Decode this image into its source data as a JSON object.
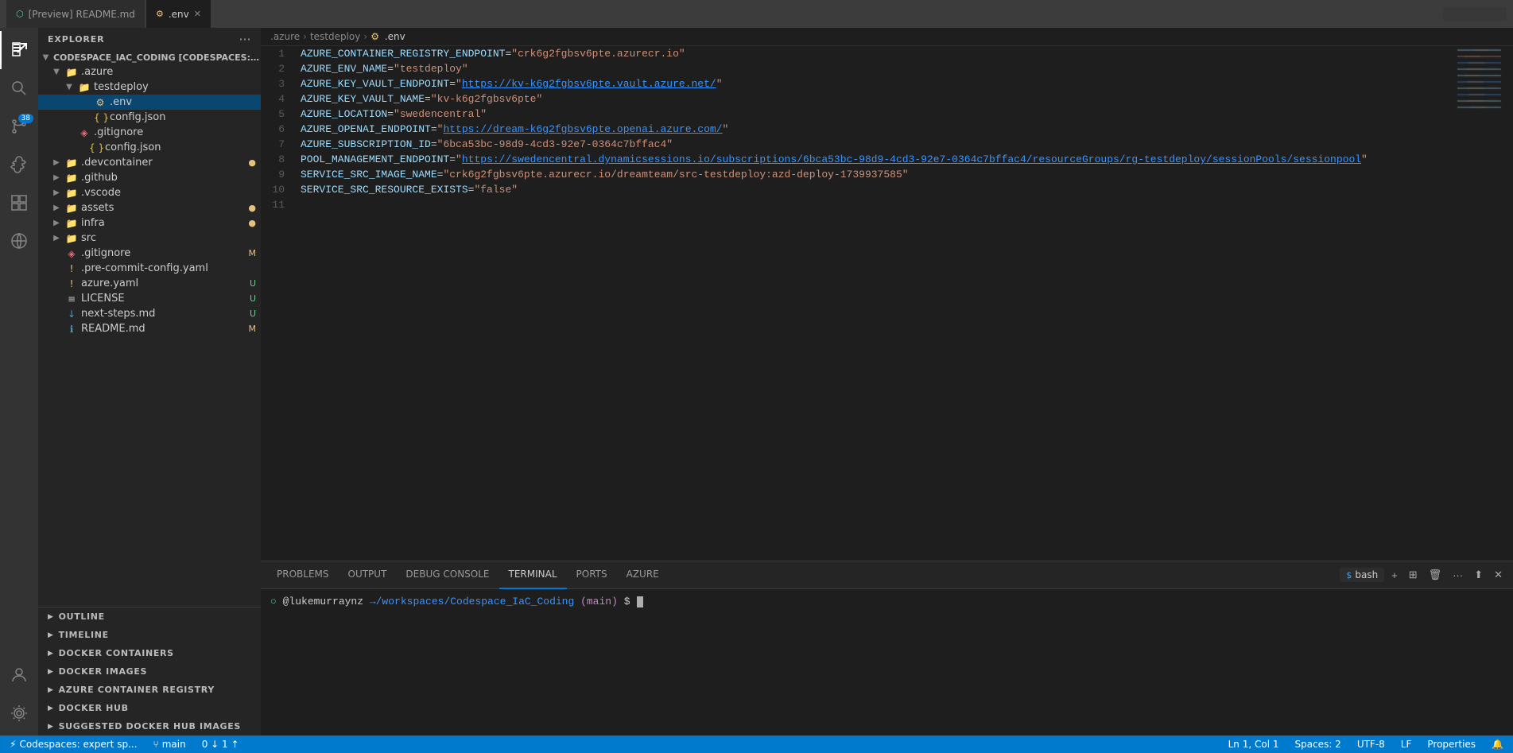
{
  "titlebar": {
    "tabs": [
      {
        "id": "preview-readme",
        "label": "[Preview] README.md",
        "icon": "preview",
        "active": false
      },
      {
        "id": "env",
        "label": ".env",
        "icon": "env",
        "active": true,
        "closeable": true
      }
    ]
  },
  "breadcrumb": {
    "parts": [
      ".azure",
      "testdeploy",
      ".env"
    ]
  },
  "activity": {
    "items": [
      {
        "id": "explorer",
        "icon": "files",
        "active": true
      },
      {
        "id": "search",
        "icon": "search",
        "active": false
      },
      {
        "id": "git",
        "icon": "git",
        "active": false,
        "badge": "38"
      },
      {
        "id": "debug",
        "icon": "debug",
        "active": false
      },
      {
        "id": "extensions",
        "icon": "extensions",
        "active": false
      },
      {
        "id": "remote",
        "icon": "remote",
        "active": false
      },
      {
        "id": "accounts",
        "icon": "accounts",
        "active": false
      },
      {
        "id": "settings",
        "icon": "settings",
        "active": false
      }
    ]
  },
  "sidebar": {
    "title": "EXPLORER",
    "root_label": "CODESPACE_IAC_CODING [CODESPACES: EXPERT SP...]",
    "tree": [
      {
        "indent": 0,
        "type": "folder-open",
        "label": ".azure",
        "expanded": true
      },
      {
        "indent": 1,
        "type": "folder-open",
        "label": "testdeploy",
        "expanded": true
      },
      {
        "indent": 2,
        "type": "file-env",
        "label": ".env",
        "selected": true
      },
      {
        "indent": 3,
        "type": "file-json",
        "label": "config.json"
      },
      {
        "indent": 1,
        "type": "file-gitignore",
        "label": ".gitignore"
      },
      {
        "indent": 2,
        "type": "file-json",
        "label": "config.json"
      },
      {
        "indent": 0,
        "type": "folder",
        "label": ".devcontainer",
        "badge": "dot"
      },
      {
        "indent": 0,
        "type": "folder",
        "label": ".github"
      },
      {
        "indent": 0,
        "type": "folder",
        "label": ".vscode"
      },
      {
        "indent": 0,
        "type": "folder",
        "label": "assets",
        "badge": "dot"
      },
      {
        "indent": 0,
        "type": "folder",
        "label": "infra",
        "badge": "dot"
      },
      {
        "indent": 0,
        "type": "folder",
        "label": "src"
      },
      {
        "indent": 0,
        "type": "file-gitignore",
        "label": ".gitignore",
        "badge": "M"
      },
      {
        "indent": 0,
        "type": "file-warning",
        "label": ".pre-commit-config.yaml"
      },
      {
        "indent": 0,
        "type": "file-warning",
        "label": "azure.yaml",
        "badge": "U"
      },
      {
        "indent": 0,
        "type": "file-license",
        "label": "LICENSE",
        "badge": "U"
      },
      {
        "indent": 0,
        "type": "file-md",
        "label": "next-steps.md",
        "badge": "U"
      },
      {
        "indent": 0,
        "type": "file-info",
        "label": "README.md",
        "badge": "M"
      }
    ],
    "bottom_sections": [
      {
        "id": "outline",
        "label": "OUTLINE"
      },
      {
        "id": "timeline",
        "label": "TIMELINE"
      },
      {
        "id": "docker-containers",
        "label": "DOCKER CONTAINERS"
      },
      {
        "id": "docker-images",
        "label": "DOCKER IMAGES"
      },
      {
        "id": "azure-container-registry",
        "label": "AZURE CONTAINER REGISTRY"
      },
      {
        "id": "docker-hub",
        "label": "DOCKER HUB"
      },
      {
        "id": "suggested-docker-hub-images",
        "label": "SUGGESTED DOCKER HUB IMAGES"
      }
    ]
  },
  "editor": {
    "filename": ".env",
    "lines": [
      {
        "num": 1,
        "key": "AZURE_CONTAINER_REGISTRY_ENDPOINT",
        "value": "\"crk6g2fgbsv6pte.azurecr.io\""
      },
      {
        "num": 2,
        "key": "AZURE_ENV_NAME",
        "value": "\"testdeploy\""
      },
      {
        "num": 3,
        "key": "AZURE_KEY_VAULT_ENDPOINT",
        "value": "\"https://kv-k6g2fgbsv6pte.vault.azure.net/\"",
        "is_url": true
      },
      {
        "num": 4,
        "key": "AZURE_KEY_VAULT_NAME",
        "value": "\"kv-k6g2fgbsv6pte\""
      },
      {
        "num": 5,
        "key": "AZURE_LOCATION",
        "value": "\"swedencentral\""
      },
      {
        "num": 6,
        "key": "AZURE_OPENAI_ENDPOINT",
        "value": "\"https://dream-k6g2fgbsv6pte.openai.azure.com/\"",
        "is_url": true
      },
      {
        "num": 7,
        "key": "AZURE_SUBSCRIPTION_ID",
        "value": "\"6bca53bc-98d9-4cd3-92e7-0364c7bffac4\""
      },
      {
        "num": 8,
        "key": "POOL_MANAGEMENT_ENDPOINT",
        "value": "\"https://swedencentral.dynamicsessions.io/subscriptions/6bca53bc-98d9-4cd3-92e7-0364c7bffac4/resourceGroups/rg-testdeploy/sessionPools/sessionpool\"",
        "is_url": true
      },
      {
        "num": 9,
        "key": "SERVICE_SRC_IMAGE_NAME",
        "value": "\"crk6g2fgbsv6pte.azurecr.io/dreamteam/src-testdeploy:azd-deploy-1739937585\""
      },
      {
        "num": 10,
        "key": "SERVICE_SRC_RESOURCE_EXISTS",
        "value": "\"false\""
      },
      {
        "num": 11,
        "key": "",
        "value": ""
      }
    ]
  },
  "terminal": {
    "tabs": [
      "PROBLEMS",
      "OUTPUT",
      "DEBUG CONSOLE",
      "TERMINAL",
      "PORTS",
      "AZURE"
    ],
    "active_tab": "TERMINAL",
    "bash_label": "bash",
    "prompt": "@lukemurraynz",
    "path": "→/workspaces/Codespace_IaC_Coding",
    "branch": "(main)",
    "symbol": "$"
  },
  "status_bar": {
    "left": [
      {
        "id": "remote",
        "text": "Codespaces: expert sp..."
      },
      {
        "id": "branch",
        "text": "main"
      },
      {
        "id": "sync",
        "text": "0 ↓ 1 ↑"
      }
    ],
    "right": [
      {
        "id": "ln-col",
        "text": "Ln 1, Col 1"
      },
      {
        "id": "spaces",
        "text": "Spaces: 2"
      },
      {
        "id": "encoding",
        "text": "UTF-8"
      },
      {
        "id": "eol",
        "text": "LF"
      },
      {
        "id": "language",
        "text": "Properties"
      },
      {
        "id": "notifications",
        "text": "🔔"
      }
    ]
  }
}
